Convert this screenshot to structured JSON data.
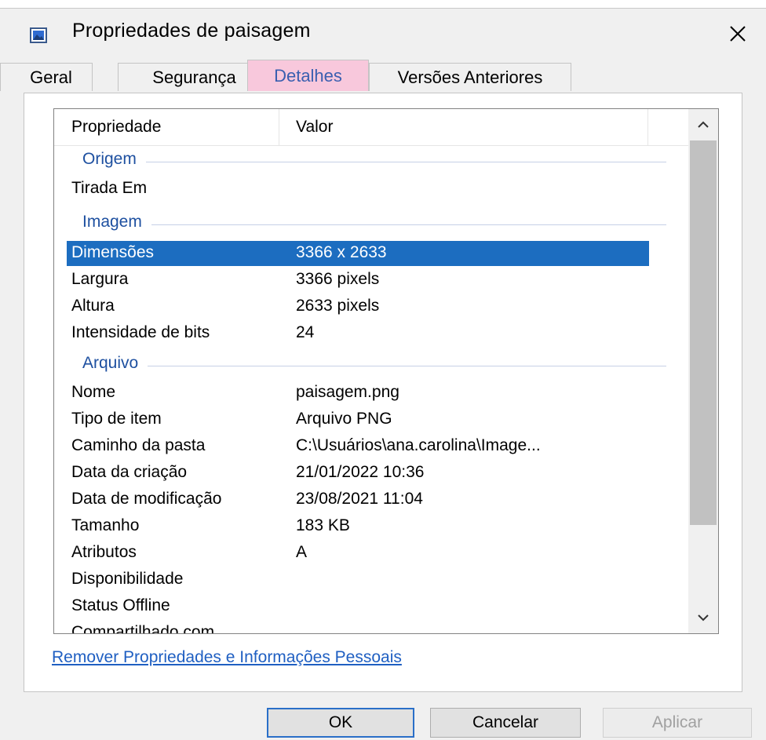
{
  "window": {
    "title": "Propriedades de paisagem",
    "close_icon": "close-icon",
    "title_icon": "image-file-icon"
  },
  "tabs": [
    {
      "label": "Geral",
      "active": false
    },
    {
      "label": "Segurança",
      "active": false
    },
    {
      "label": "Detalhes",
      "active": true
    },
    {
      "label": "Versões Anteriores",
      "active": false
    }
  ],
  "details": {
    "header": {
      "property": "Propriedade",
      "value": "Valor"
    },
    "groups": {
      "origem": "Origem",
      "imagem": "Imagem",
      "arquivo": "Arquivo"
    },
    "origem_rows": [
      {
        "property": "Tirada Em",
        "value": ""
      }
    ],
    "imagem_rows": [
      {
        "property": "Dimensões",
        "value": "3366 x 2633",
        "selected": true
      },
      {
        "property": "Largura",
        "value": "3366 pixels"
      },
      {
        "property": "Altura",
        "value": "2633 pixels"
      },
      {
        "property": "Intensidade de bits",
        "value": "24"
      }
    ],
    "arquivo_rows": [
      {
        "property": "Nome",
        "value": "paisagem.png"
      },
      {
        "property": "Tipo de item",
        "value": "Arquivo PNG"
      },
      {
        "property": "Caminho da pasta",
        "value": "C:\\Usuários\\ana.carolina\\Image..."
      },
      {
        "property": "Data da criação",
        "value": "21/01/2022 10:36"
      },
      {
        "property": "Data de modificação",
        "value": "23/08/2021 11:04"
      },
      {
        "property": "Tamanho",
        "value": "183 KB"
      },
      {
        "property": "Atributos",
        "value": "A"
      },
      {
        "property": "Disponibilidade",
        "value": ""
      },
      {
        "property": "Status Offline",
        "value": ""
      },
      {
        "property": "Compartilhado com",
        "value": ""
      }
    ]
  },
  "link": {
    "label": "Remover Propriedades e Informações Pessoais"
  },
  "buttons": {
    "ok": "OK",
    "cancel": "Cancelar",
    "apply": "Aplicar"
  },
  "colors": {
    "selection": "#1c6dc0",
    "group_label": "#1e50a0",
    "active_tab": "#f8c8dc",
    "link": "#1f5fc2"
  }
}
